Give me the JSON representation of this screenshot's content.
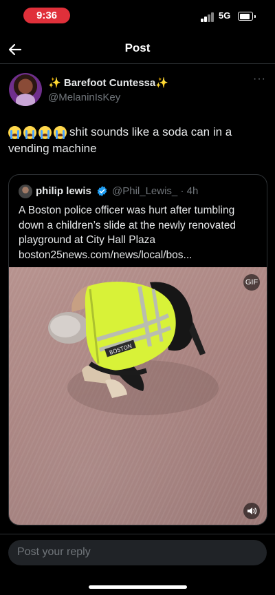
{
  "status_bar": {
    "time": "9:36",
    "network": "5G",
    "battery_level": 0.8
  },
  "header": {
    "title": "Post",
    "back_icon": "arrow-left-icon"
  },
  "post": {
    "author_sparkle_left": "✨",
    "author_name": "Barefoot Cuntessa",
    "author_sparkle_right": "✨",
    "handle": "@MelaninIsKey",
    "emoji_count": 4,
    "emoji_name": "loudly-crying-face-icon",
    "text": "shit sounds like a soda can in a vending machine",
    "more_label": "···"
  },
  "quote": {
    "author_name": "philip lewis",
    "handle_time": "@Phil_Lewis_ · 4h",
    "text": "A Boston police officer was hurt after tumbling down a children’s slide at the newly renovated playground at City Hall Plaza",
    "link": "boston25news.com/news/local/bos...",
    "vest_text": "BOSTON",
    "gif_label": "GIF"
  },
  "reply": {
    "placeholder": "Post your reply"
  },
  "colors": {
    "accent": "#1d9bf0",
    "time_pill": "#e0303a",
    "vest": "#d8f238"
  }
}
